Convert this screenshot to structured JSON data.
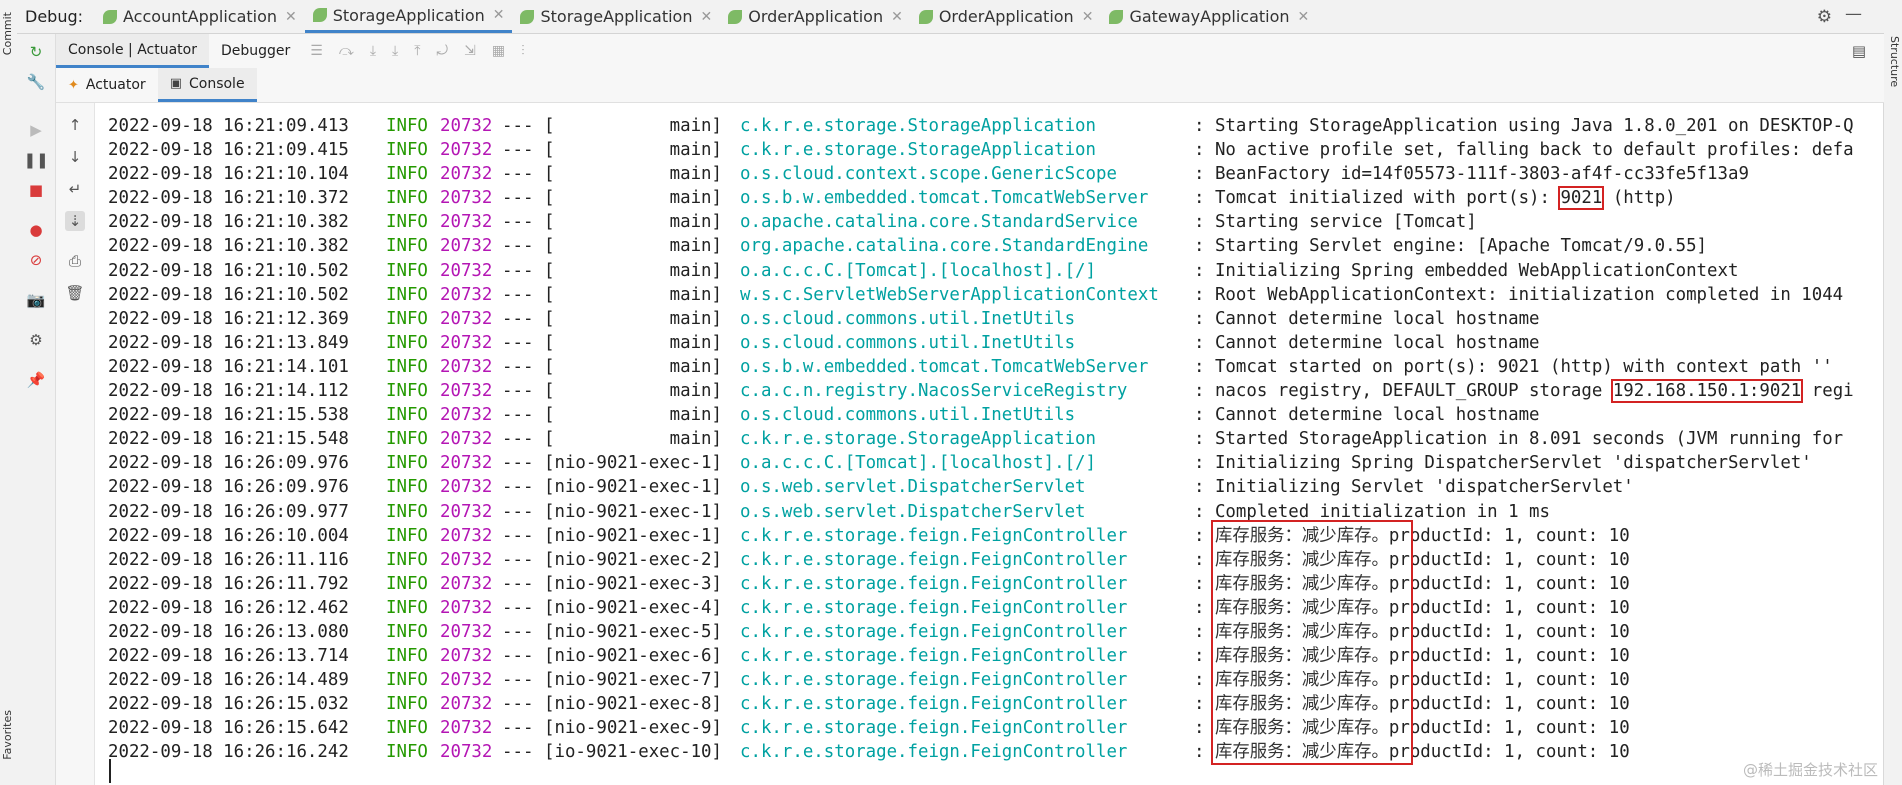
{
  "debug_label": "Debug:",
  "tabs": [
    {
      "label": "AccountApplication",
      "active": false
    },
    {
      "label": "StorageApplication",
      "active": true
    },
    {
      "label": "StorageApplication",
      "active": false
    },
    {
      "label": "OrderApplication",
      "active": false
    },
    {
      "label": "OrderApplication",
      "active": false
    },
    {
      "label": "GatewayApplication",
      "active": false
    }
  ],
  "side": {
    "left_top": "Commit",
    "left_bottom": "Favorites",
    "right_top": "Structure"
  },
  "subtoolbar": {
    "console_actuator": "Console | Actuator",
    "debugger": "Debugger"
  },
  "subtabs": {
    "actuator": "Actuator",
    "console": "Console"
  },
  "colors": {
    "accent": "#4083c9",
    "info": "#249900",
    "pid": "#b416b4",
    "logger": "#00a1a1",
    "highlight": "#d32323"
  },
  "console": {
    "lines": [
      {
        "ts": "2022-09-18 16:21:09.413",
        "level": "INFO",
        "pid": "20732",
        "sep": "---",
        "thread": "[           main]",
        "logger": "c.k.r.e.storage.StorageApplication",
        "msg": ": Starting StorageApplication using Java 1.8.0_201 on DESKTOP-Q"
      },
      {
        "ts": "2022-09-18 16:21:09.415",
        "level": "INFO",
        "pid": "20732",
        "sep": "---",
        "thread": "[           main]",
        "logger": "c.k.r.e.storage.StorageApplication",
        "msg": ": No active profile set, falling back to default profiles: defa"
      },
      {
        "ts": "2022-09-18 16:21:10.104",
        "level": "INFO",
        "pid": "20732",
        "sep": "---",
        "thread": "[           main]",
        "logger": "o.s.cloud.context.scope.GenericScope",
        "msg": ": BeanFactory id=14f05573-111f-3803-af4f-cc33fe5f13a9"
      },
      {
        "ts": "2022-09-18 16:21:10.372",
        "level": "INFO",
        "pid": "20732",
        "sep": "---",
        "thread": "[           main]",
        "logger": "o.s.b.w.embedded.tomcat.TomcatWebServer",
        "msg_pre": ": Tomcat initialized with port(s): ",
        "msg_box": "9021",
        "msg_post": " (http)"
      },
      {
        "ts": "2022-09-18 16:21:10.382",
        "level": "INFO",
        "pid": "20732",
        "sep": "---",
        "thread": "[           main]",
        "logger": "o.apache.catalina.core.StandardService",
        "msg": ": Starting service [Tomcat]"
      },
      {
        "ts": "2022-09-18 16:21:10.382",
        "level": "INFO",
        "pid": "20732",
        "sep": "---",
        "thread": "[           main]",
        "logger": "org.apache.catalina.core.StandardEngine",
        "msg": ": Starting Servlet engine: [Apache Tomcat/9.0.55]"
      },
      {
        "ts": "2022-09-18 16:21:10.502",
        "level": "INFO",
        "pid": "20732",
        "sep": "---",
        "thread": "[           main]",
        "logger": "o.a.c.c.C.[Tomcat].[localhost].[/]",
        "msg": ": Initializing Spring embedded WebApplicationContext"
      },
      {
        "ts": "2022-09-18 16:21:10.502",
        "level": "INFO",
        "pid": "20732",
        "sep": "---",
        "thread": "[           main]",
        "logger": "w.s.c.ServletWebServerApplicationContext",
        "msg": ": Root WebApplicationContext: initialization completed in 1044"
      },
      {
        "ts": "2022-09-18 16:21:12.369",
        "level": "INFO",
        "pid": "20732",
        "sep": "---",
        "thread": "[           main]",
        "logger": "o.s.cloud.commons.util.InetUtils",
        "msg": ": Cannot determine local hostname"
      },
      {
        "ts": "2022-09-18 16:21:13.849",
        "level": "INFO",
        "pid": "20732",
        "sep": "---",
        "thread": "[           main]",
        "logger": "o.s.cloud.commons.util.InetUtils",
        "msg": ": Cannot determine local hostname"
      },
      {
        "ts": "2022-09-18 16:21:14.101",
        "level": "INFO",
        "pid": "20732",
        "sep": "---",
        "thread": "[           main]",
        "logger": "o.s.b.w.embedded.tomcat.TomcatWebServer",
        "msg": ": Tomcat started on port(s): 9021 (http) with context path ''"
      },
      {
        "ts": "2022-09-18 16:21:14.112",
        "level": "INFO",
        "pid": "20732",
        "sep": "---",
        "thread": "[           main]",
        "logger": "c.a.c.n.registry.NacosServiceRegistry",
        "msg_pre": ": nacos registry, DEFAULT_GROUP storage ",
        "msg_box": "192.168.150.1:9021",
        "msg_post": " regi"
      },
      {
        "ts": "2022-09-18 16:21:15.538",
        "level": "INFO",
        "pid": "20732",
        "sep": "---",
        "thread": "[           main]",
        "logger": "o.s.cloud.commons.util.InetUtils",
        "msg": ": Cannot determine local hostname"
      },
      {
        "ts": "2022-09-18 16:21:15.548",
        "level": "INFO",
        "pid": "20732",
        "sep": "---",
        "thread": "[           main]",
        "logger": "c.k.r.e.storage.StorageApplication",
        "msg": ": Started StorageApplication in 8.091 seconds (JVM running for"
      },
      {
        "ts": "2022-09-18 16:26:09.976",
        "level": "INFO",
        "pid": "20732",
        "sep": "---",
        "thread": "[nio-9021-exec-1]",
        "logger": "o.a.c.c.C.[Tomcat].[localhost].[/]",
        "msg": ": Initializing Spring DispatcherServlet 'dispatcherServlet'"
      },
      {
        "ts": "2022-09-18 16:26:09.976",
        "level": "INFO",
        "pid": "20732",
        "sep": "---",
        "thread": "[nio-9021-exec-1]",
        "logger": "o.s.web.servlet.DispatcherServlet",
        "msg": ": Initializing Servlet 'dispatcherServlet'"
      },
      {
        "ts": "2022-09-18 16:26:09.977",
        "level": "INFO",
        "pid": "20732",
        "sep": "---",
        "thread": "[nio-9021-exec-1]",
        "logger": "o.s.web.servlet.DispatcherServlet",
        "msg": ": Completed initialization in 1 ms"
      },
      {
        "ts": "2022-09-18 16:26:10.004",
        "level": "INFO",
        "pid": "20732",
        "sep": "---",
        "thread": "[nio-9021-exec-1]",
        "logger": "c.k.r.e.storage.feign.FeignController",
        "msg_pre": ": ",
        "msg_cn": "库存服务：减少库存。",
        "msg_post": "productId: 1, count: 10"
      },
      {
        "ts": "2022-09-18 16:26:11.116",
        "level": "INFO",
        "pid": "20732",
        "sep": "---",
        "thread": "[nio-9021-exec-2]",
        "logger": "c.k.r.e.storage.feign.FeignController",
        "msg_pre": ": ",
        "msg_cn": "库存服务：减少库存。",
        "msg_post": "productId: 1, count: 10"
      },
      {
        "ts": "2022-09-18 16:26:11.792",
        "level": "INFO",
        "pid": "20732",
        "sep": "---",
        "thread": "[nio-9021-exec-3]",
        "logger": "c.k.r.e.storage.feign.FeignController",
        "msg_pre": ": ",
        "msg_cn": "库存服务：减少库存。",
        "msg_post": "productId: 1, count: 10"
      },
      {
        "ts": "2022-09-18 16:26:12.462",
        "level": "INFO",
        "pid": "20732",
        "sep": "---",
        "thread": "[nio-9021-exec-4]",
        "logger": "c.k.r.e.storage.feign.FeignController",
        "msg_pre": ": ",
        "msg_cn": "库存服务：减少库存。",
        "msg_post": "productId: 1, count: 10"
      },
      {
        "ts": "2022-09-18 16:26:13.080",
        "level": "INFO",
        "pid": "20732",
        "sep": "---",
        "thread": "[nio-9021-exec-5]",
        "logger": "c.k.r.e.storage.feign.FeignController",
        "msg_pre": ": ",
        "msg_cn": "库存服务：减少库存。",
        "msg_post": "productId: 1, count: 10"
      },
      {
        "ts": "2022-09-18 16:26:13.714",
        "level": "INFO",
        "pid": "20732",
        "sep": "---",
        "thread": "[nio-9021-exec-6]",
        "logger": "c.k.r.e.storage.feign.FeignController",
        "msg_pre": ": ",
        "msg_cn": "库存服务：减少库存。",
        "msg_post": "productId: 1, count: 10"
      },
      {
        "ts": "2022-09-18 16:26:14.489",
        "level": "INFO",
        "pid": "20732",
        "sep": "---",
        "thread": "[nio-9021-exec-7]",
        "logger": "c.k.r.e.storage.feign.FeignController",
        "msg_pre": ": ",
        "msg_cn": "库存服务：减少库存。",
        "msg_post": "productId: 1, count: 10"
      },
      {
        "ts": "2022-09-18 16:26:15.032",
        "level": "INFO",
        "pid": "20732",
        "sep": "---",
        "thread": "[nio-9021-exec-8]",
        "logger": "c.k.r.e.storage.feign.FeignController",
        "msg_pre": ": ",
        "msg_cn": "库存服务：减少库存。",
        "msg_post": "productId: 1, count: 10"
      },
      {
        "ts": "2022-09-18 16:26:15.642",
        "level": "INFO",
        "pid": "20732",
        "sep": "---",
        "thread": "[nio-9021-exec-9]",
        "logger": "c.k.r.e.storage.feign.FeignController",
        "msg_pre": ": ",
        "msg_cn": "库存服务：减少库存。",
        "msg_post": "productId: 1, count: 10"
      },
      {
        "ts": "2022-09-18 16:26:16.242",
        "level": "INFO",
        "pid": "20732",
        "sep": "---",
        "thread": "[io-9021-exec-10]",
        "logger": "c.k.r.e.storage.feign.FeignController",
        "msg_pre": ": ",
        "msg_cn": "库存服务：减少库存。",
        "msg_post": "productId: 1, count: 10"
      }
    ]
  },
  "watermark": "@稀土掘金技术社区"
}
